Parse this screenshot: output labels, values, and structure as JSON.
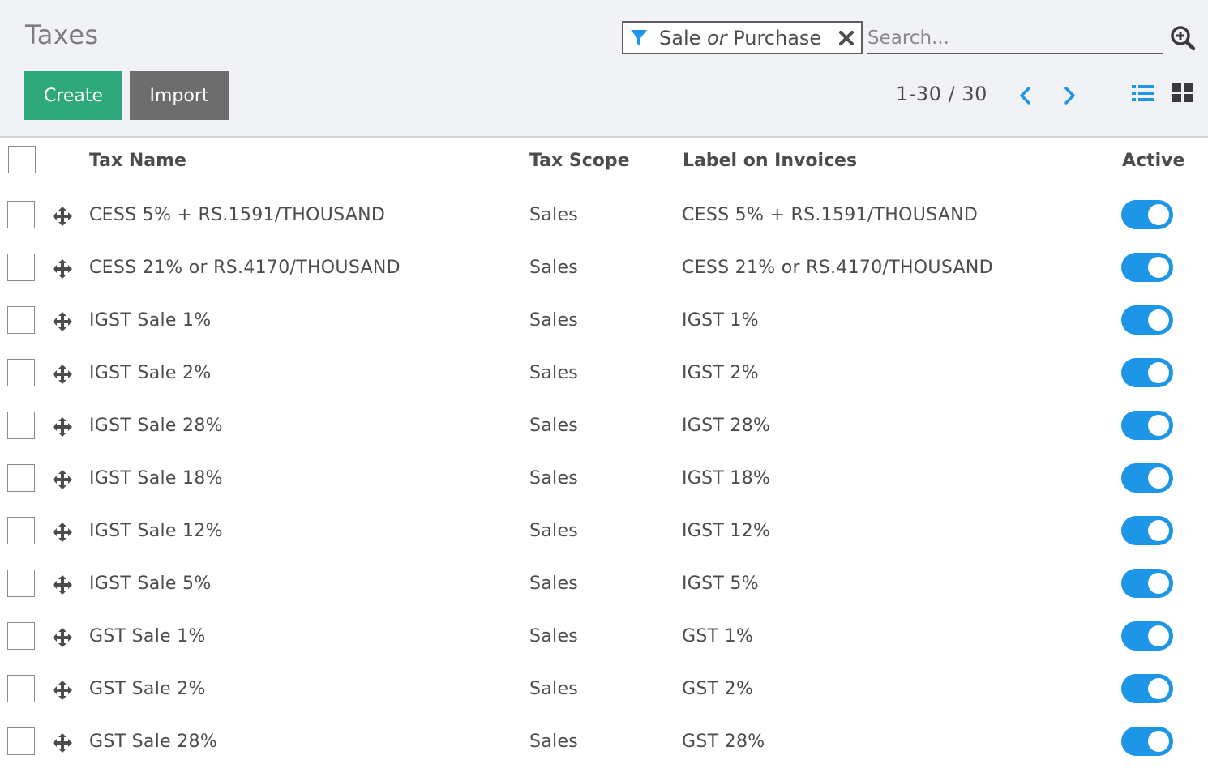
{
  "page": {
    "title": "Taxes"
  },
  "search": {
    "facet_part1": "Sale ",
    "facet_or": "or",
    "facet_part2": " Purchase",
    "placeholder": "Search..."
  },
  "toolbar": {
    "create_label": "Create",
    "import_label": "Import"
  },
  "pager": {
    "value": "1-30 / 30"
  },
  "icons": {
    "filter": "filter-icon",
    "remove": "close-icon",
    "search": "search-plus-icon",
    "prev": "chevron-left-icon",
    "next": "chevron-right-icon",
    "list_view": "list-icon",
    "kanban_view": "grid-icon",
    "handle": "move-arrows-icon"
  },
  "colors": {
    "primary": "#2fa97b",
    "secondary": "#6d6d6d",
    "toggle_on": "#1e96e8",
    "link": "#1e96e8",
    "panel_bg": "#f1f2f6"
  },
  "table": {
    "headers": {
      "name": "Tax Name",
      "scope": "Tax Scope",
      "label": "Label on Invoices",
      "active": "Active"
    },
    "rows": [
      {
        "name": "CESS 5% + RS.1591/THOUSAND",
        "scope": "Sales",
        "label": "CESS 5% + RS.1591/THOUSAND",
        "active": true
      },
      {
        "name": "CESS 21% or RS.4170/THOUSAND",
        "scope": "Sales",
        "label": "CESS 21% or RS.4170/THOUSAND",
        "active": true
      },
      {
        "name": "IGST Sale 1%",
        "scope": "Sales",
        "label": "IGST 1%",
        "active": true
      },
      {
        "name": "IGST Sale 2%",
        "scope": "Sales",
        "label": "IGST 2%",
        "active": true
      },
      {
        "name": "IGST Sale 28%",
        "scope": "Sales",
        "label": "IGST 28%",
        "active": true
      },
      {
        "name": "IGST Sale 18%",
        "scope": "Sales",
        "label": "IGST 18%",
        "active": true
      },
      {
        "name": "IGST Sale 12%",
        "scope": "Sales",
        "label": "IGST 12%",
        "active": true
      },
      {
        "name": "IGST Sale 5%",
        "scope": "Sales",
        "label": "IGST 5%",
        "active": true
      },
      {
        "name": "GST Sale 1%",
        "scope": "Sales",
        "label": "GST 1%",
        "active": true
      },
      {
        "name": "GST Sale 2%",
        "scope": "Sales",
        "label": "GST 2%",
        "active": true
      },
      {
        "name": "GST Sale 28%",
        "scope": "Sales",
        "label": "GST 28%",
        "active": true
      }
    ]
  }
}
